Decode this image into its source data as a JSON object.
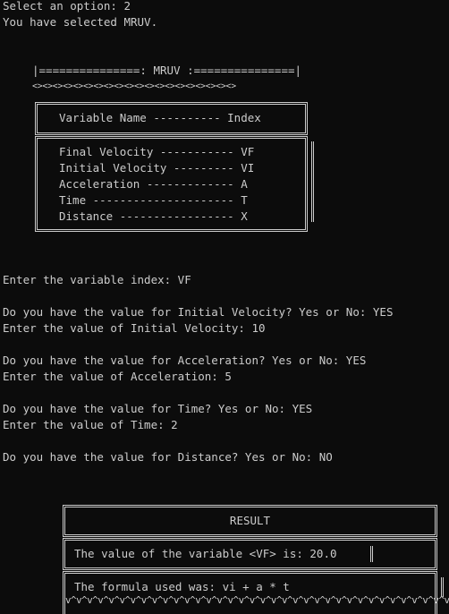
{
  "console": {
    "option_prompt": "Select an option: 2",
    "selected_msg": "You have selected MRUV."
  },
  "banner": {
    "header": "|===============: MRUV :===============|",
    "decor": "<><><><><><><><><><><><><><><><><><><><>"
  },
  "variables_table": {
    "header": "Variable Name ---------- Index",
    "rows": [
      "Final Velocity ----------- VF",
      "Initial Velocity --------- VI",
      "Acceleration ------------- A",
      "Time --------------------- T",
      "Distance ----------------- X"
    ]
  },
  "dialog": {
    "index_prompt": "Enter the variable index: VF",
    "q_vi": "Do you have the value for Initial Velocity? Yes or No: YES",
    "v_vi": "Enter the value of Initial Velocity: 10",
    "q_a": "Do you have the value for Acceleration? Yes or No: YES",
    "v_a": "Enter the value of Acceleration: 5",
    "q_t": "Do you have the value for Time? Yes or No: YES",
    "v_t": "Enter the value of Time: 2",
    "q_x": "Do you have the value for Distance? Yes or No: NO"
  },
  "result_box": {
    "title": "RESULT",
    "value_line": "The value of the variable <VF> is: 20.0",
    "formula_line": "The formula used was: vi + a * t",
    "decor": "v^v^v^v^v^v^v^v^v^v^v^v^v^v^v^v^v^v^v^v^v^v^v^v^v^v^v^v^v^v^v^v^v^v^v^v"
  }
}
